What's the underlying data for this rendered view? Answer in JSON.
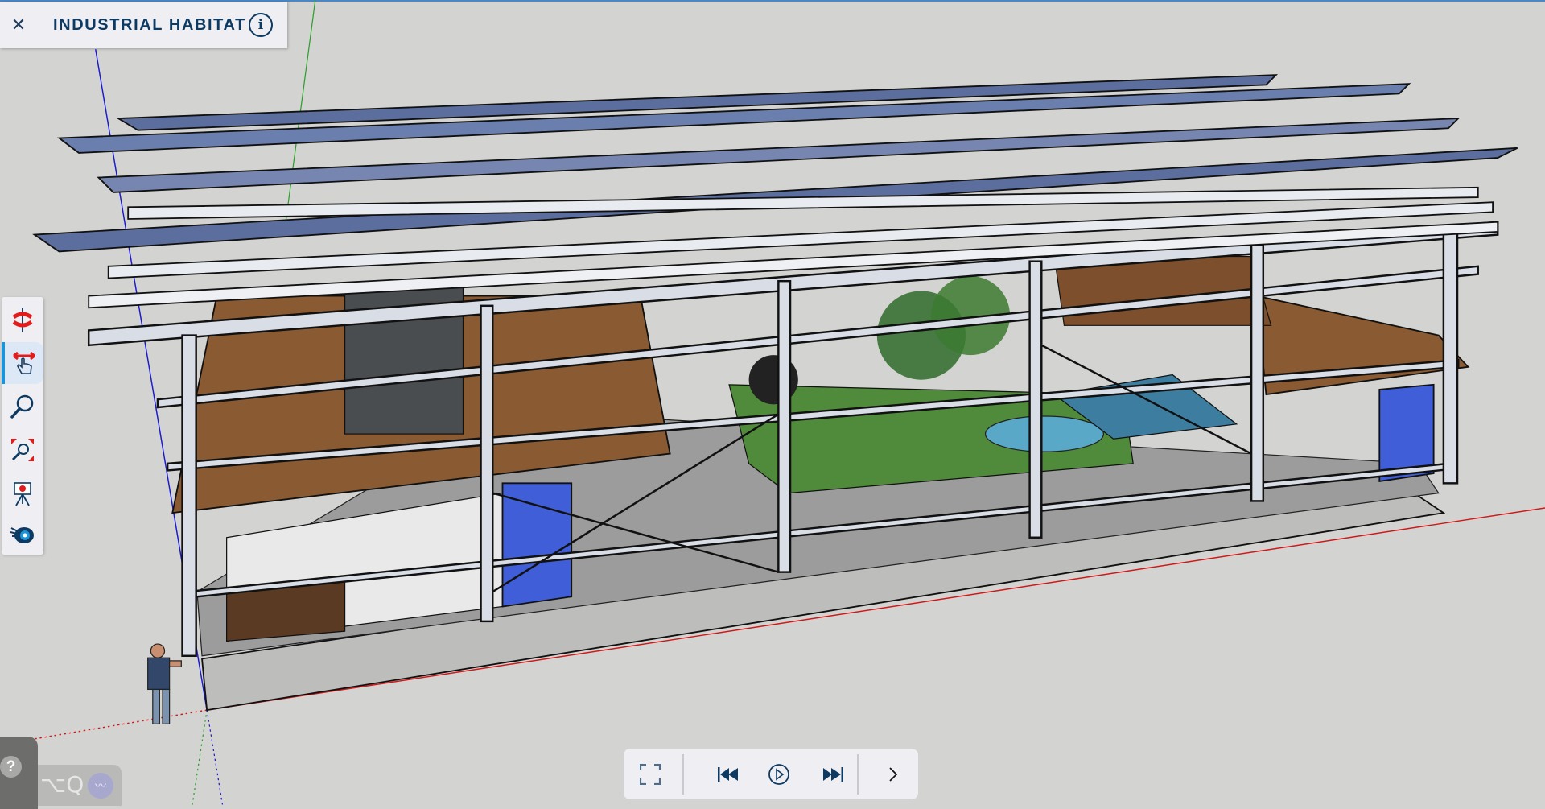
{
  "header": {
    "title": "INDUSTRIAL HABITAT",
    "close_icon": "close-icon",
    "info_icon": "info-icon",
    "info_glyph": "i"
  },
  "toolbar": {
    "tools": [
      {
        "name": "orbit",
        "icon": "orbit-icon"
      },
      {
        "name": "pan",
        "icon": "pan-icon",
        "active": true
      },
      {
        "name": "zoom",
        "icon": "zoom-icon"
      },
      {
        "name": "zoom-extents",
        "icon": "zoom-extents-icon"
      },
      {
        "name": "position-camera",
        "icon": "camera-tripod-icon"
      },
      {
        "name": "look-around",
        "icon": "eye-icon"
      }
    ]
  },
  "player": {
    "buttons": [
      "fullscreen",
      "previous-scene",
      "play",
      "next-scene",
      "expand"
    ]
  },
  "help": {
    "glyph": "?"
  },
  "shortcut": {
    "text": "⌥Q",
    "icon": "waveform-icon"
  },
  "colors": {
    "accent": "#1b94d8",
    "title": "#0d3a63",
    "background": "#d3d3d1",
    "wood": "#8a5a33",
    "container": "#3f5ed8"
  }
}
